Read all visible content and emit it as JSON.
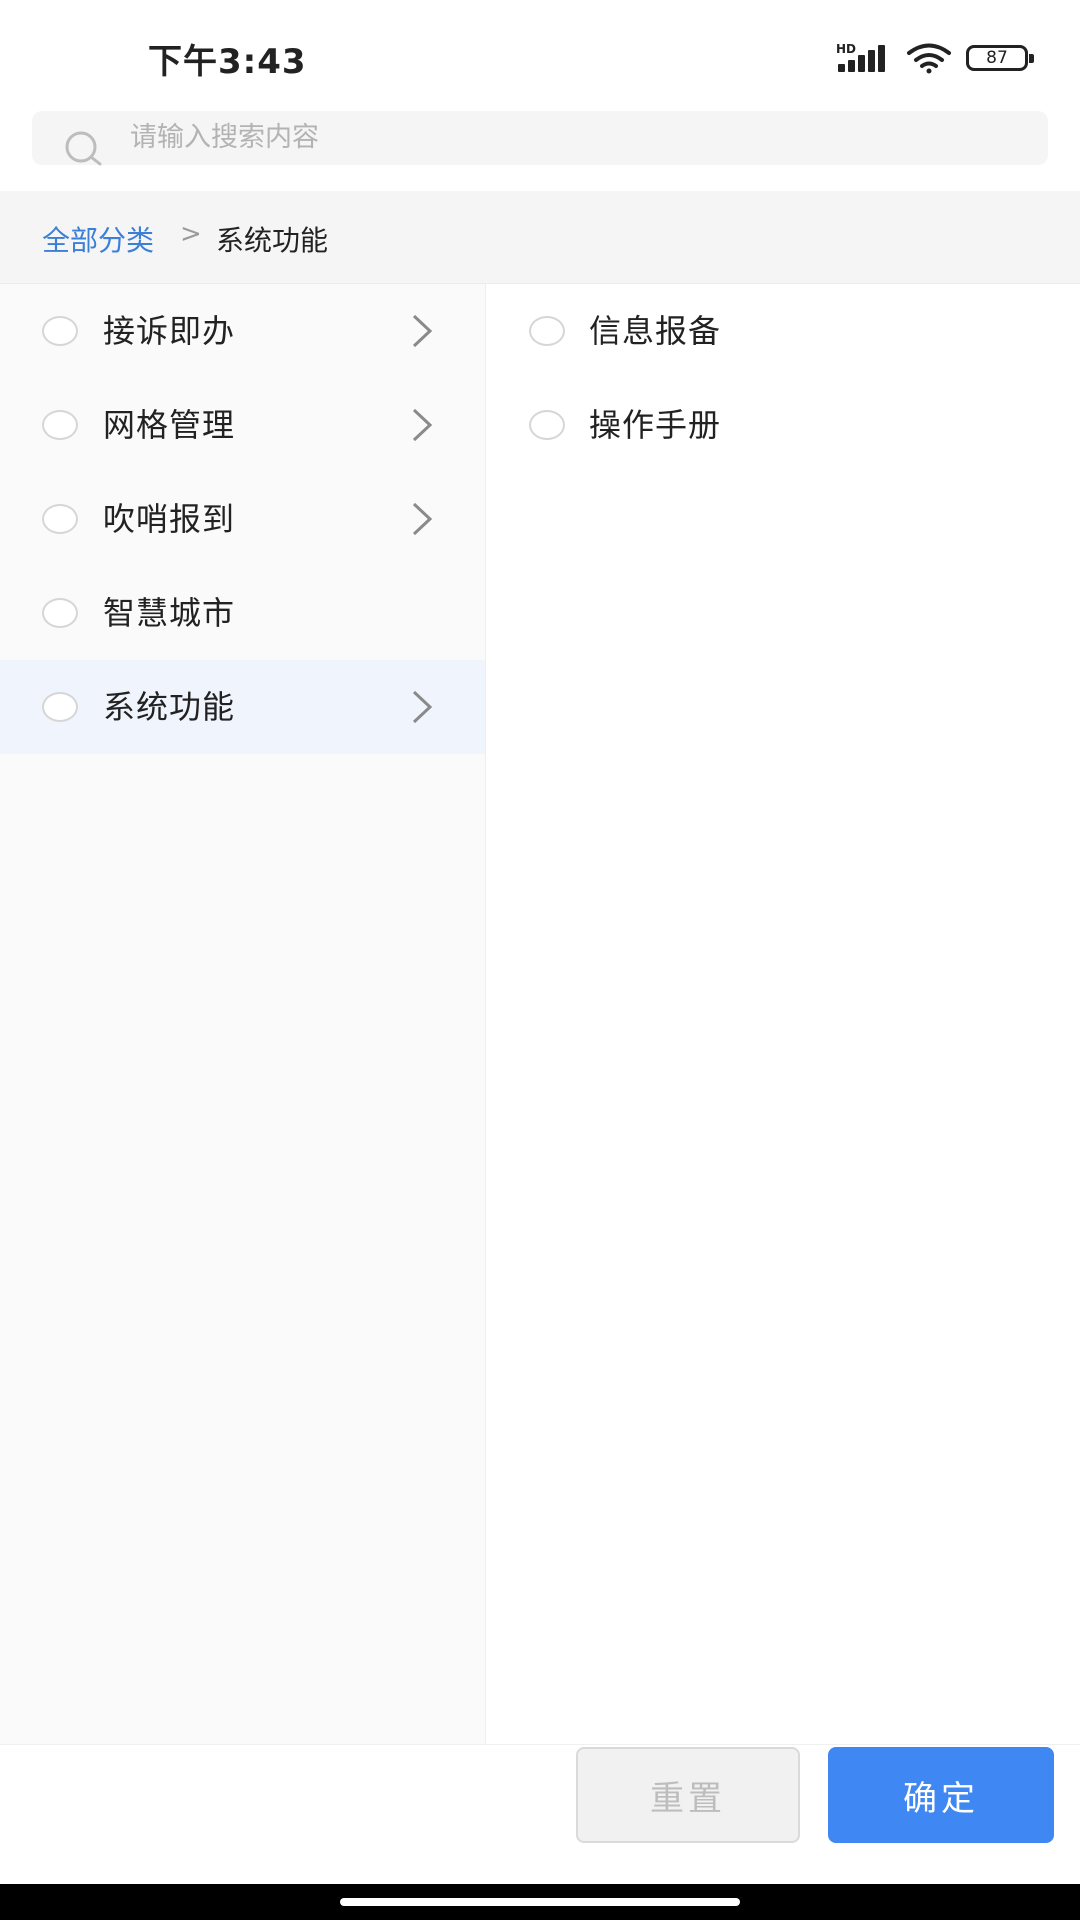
{
  "status_bar": {
    "time": "下午3:43",
    "network_label": "HD",
    "battery": "87"
  },
  "search": {
    "placeholder": "请输入搜索内容"
  },
  "breadcrumb": {
    "root": "全部分类",
    "separator": ">",
    "current": "系统功能"
  },
  "categories": [
    {
      "label": "接诉即办",
      "has_children": true,
      "selected": false
    },
    {
      "label": "网格管理",
      "has_children": true,
      "selected": false
    },
    {
      "label": "吹哨报到",
      "has_children": true,
      "selected": false
    },
    {
      "label": "智慧城市",
      "has_children": false,
      "selected": false
    },
    {
      "label": "系统功能",
      "has_children": true,
      "selected": true
    }
  ],
  "subcategories": [
    {
      "label": "信息报备"
    },
    {
      "label": "操作手册"
    }
  ],
  "footer": {
    "reset_label": "重置",
    "confirm_label": "确定"
  },
  "colors": {
    "accent": "#3f87f2",
    "link": "#3c7fd7",
    "selected_row": "#f0f5fd"
  }
}
